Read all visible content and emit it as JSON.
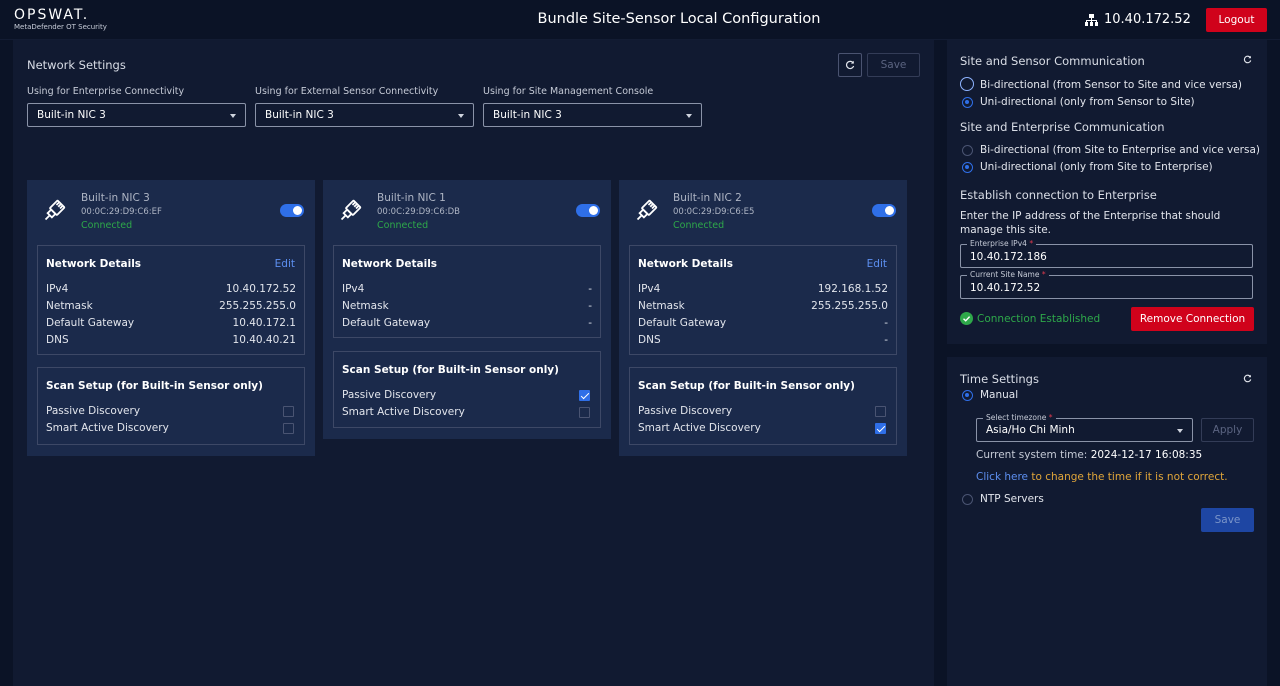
{
  "header": {
    "logo_text": "OPSWAT.",
    "logo_subtitle": "MetaDefender OT Security",
    "title": "Bundle Site-Sensor Local Configuration",
    "ip_icon": "network-icon",
    "ip_address": "10.40.172.52",
    "logout_label": "Logout"
  },
  "network_settings": {
    "title": "Network Settings",
    "refresh_icon": "refresh-icon",
    "save_label": "Save",
    "selects": [
      {
        "label": "Using for Enterprise Connectivity",
        "value": "Built-in NIC 3"
      },
      {
        "label": "Using for External Sensor Connectivity",
        "value": "Built-in NIC 3"
      },
      {
        "label": "Using for Site Management Console",
        "value": "Built-in NIC 3"
      }
    ],
    "nics": [
      {
        "name": "Built-in NIC 3",
        "mac": "00:0C:29:D9:C6:EF",
        "status": "Connected",
        "details_title": "Network Details",
        "edit_label": "Edit",
        "rows": [
          {
            "key": "IPv4",
            "value": "10.40.172.52"
          },
          {
            "key": "Netmask",
            "value": "255.255.255.0"
          },
          {
            "key": "Default Gateway",
            "value": "10.40.172.1"
          },
          {
            "key": "DNS",
            "value": "10.40.40.21"
          }
        ],
        "scan_title": "Scan Setup (for Built-in Sensor only)",
        "scan_items": [
          {
            "label": "Passive Discovery",
            "checked": false
          },
          {
            "label": "Smart Active Discovery",
            "checked": false
          }
        ]
      },
      {
        "name": "Built-in NIC 1",
        "mac": "00:0C:29:D9:C6:DB",
        "status": "Connected",
        "details_title": "Network Details",
        "rows": [
          {
            "key": "IPv4",
            "value": "-"
          },
          {
            "key": "Netmask",
            "value": "-"
          },
          {
            "key": "Default Gateway",
            "value": "-"
          }
        ],
        "scan_title": "Scan Setup (for Built-in Sensor only)",
        "scan_items": [
          {
            "label": "Passive Discovery",
            "checked": true
          },
          {
            "label": "Smart Active Discovery",
            "checked": false
          }
        ]
      },
      {
        "name": "Built-in NIC 2",
        "mac": "00:0C:29:D9:C6:E5",
        "status": "Connected",
        "details_title": "Network Details",
        "edit_label": "Edit",
        "rows": [
          {
            "key": "IPv4",
            "value": "192.168.1.52"
          },
          {
            "key": "Netmask",
            "value": "255.255.255.0"
          },
          {
            "key": "Default Gateway",
            "value": "-"
          },
          {
            "key": "DNS",
            "value": "-"
          }
        ],
        "scan_title": "Scan Setup (for Built-in Sensor only)",
        "scan_items": [
          {
            "label": "Passive Discovery",
            "checked": false
          },
          {
            "label": "Smart Active Discovery",
            "checked": true
          }
        ]
      }
    ]
  },
  "communication": {
    "site_sensor_title": "Site and Sensor Communication",
    "site_sensor_options": [
      "Bi-directional (from Sensor to Site and vice versa)",
      "Uni-directional (only from Sensor to Site)"
    ],
    "site_sensor_selected": 1,
    "site_enterprise_title": "Site and Enterprise Communication",
    "site_enterprise_options": [
      "Bi-directional (from Site to Enterprise and vice versa)",
      "Uni-directional (only from Site to Enterprise)"
    ],
    "site_enterprise_selected": 1,
    "enterprise_title": "Establish connection to Enterprise",
    "enterprise_desc": "Enter the IP address of the Enterprise that should manage this site.",
    "enterprise_ip_label": "Enterprise IPv4",
    "enterprise_ip_value": "10.40.172.186",
    "site_name_label": "Current Site Name",
    "site_name_value": "10.40.172.52",
    "required_mark": "*",
    "connection_status": "Connection Established",
    "remove_label": "Remove Connection"
  },
  "time_settings": {
    "title": "Time Settings",
    "manual_label": "Manual",
    "timezone_label": "Select timezone",
    "timezone_value": "Asia/Ho Chi Minh",
    "apply_label": "Apply",
    "current_time_label": "Current system time:",
    "current_time_value": "2024-12-17 16:08:35",
    "click_here": "Click here",
    "change_text": "to change the time if it is not correct.",
    "ntp_label": "NTP Servers",
    "save_label": "Save"
  },
  "colors": {
    "background": "#0b1326",
    "panel": "#111a31",
    "card": "#1b2a4b",
    "accent": "#2f6fe8",
    "danger": "#d0021b",
    "success": "#2ea84a"
  }
}
